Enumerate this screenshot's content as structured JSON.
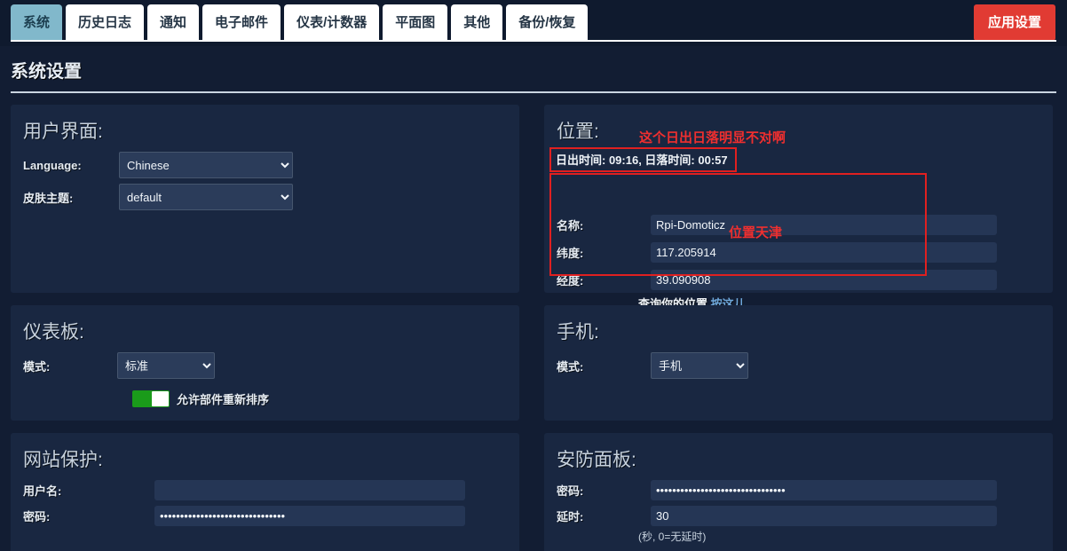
{
  "header": {
    "tabs": [
      {
        "label": "系统",
        "active": true
      },
      {
        "label": "历史日志",
        "active": false
      },
      {
        "label": "通知",
        "active": false
      },
      {
        "label": "电子邮件",
        "active": false
      },
      {
        "label": "仪表/计数器",
        "active": false
      },
      {
        "label": "平面图",
        "active": false
      },
      {
        "label": "其他",
        "active": false
      },
      {
        "label": "备份/恢复",
        "active": false
      }
    ],
    "apply_label": "应用设置",
    "apply_color": "#e13b33",
    "active_tab_color": "#81b8cb"
  },
  "page": {
    "title": "系统设置"
  },
  "user_interface": {
    "title": "用户界面:",
    "language_label": "Language:",
    "language_value": "Chinese",
    "theme_label": "皮肤主题:",
    "theme_value": "default"
  },
  "location": {
    "title": "位置:",
    "annotation_sun": "这个日出日落明显不对啊",
    "annotation_tianjin": "位置天津",
    "annotation_color": "#ef2f2f",
    "sun_times": "日出时间: 09:16, 日落时间: 00:57",
    "name_label": "名称:",
    "name_value": "Rpi-Domoticz",
    "latitude_label": "纬度:",
    "latitude_value": "117.205914",
    "longitude_label": "经度:",
    "longitude_value": "39.090908",
    "lookup_text": "查询你的位置",
    "lookup_link": "按这儿"
  },
  "dashboard": {
    "title": "仪表板:",
    "mode_label": "模式:",
    "mode_value": "标准",
    "toggle_label": "允许部件重新排序",
    "toggle_on": true,
    "toggle_color": "#1a9b1a"
  },
  "mobile": {
    "title": "手机:",
    "mode_label": "模式:",
    "mode_value": "手机"
  },
  "website_protection": {
    "title": "网站保护:",
    "username_label": "用户名:",
    "username_value": "",
    "password_label": "密码:",
    "password_value": "•••••••••••••••••••••••••••••••"
  },
  "security_panel": {
    "title": "安防面板:",
    "password_label": "密码:",
    "password_value": "••••••••••••••••••••••••••••••••",
    "delay_label": "延时:",
    "delay_value": "30",
    "delay_hint": "(秒, 0=无延时)"
  }
}
